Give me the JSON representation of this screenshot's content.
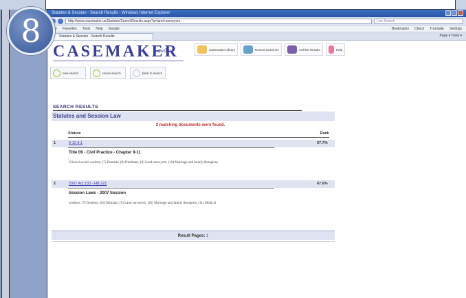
{
  "step_number": "8",
  "browser": {
    "title": "Statutes & Session - Search Results - Windows Internet Explorer",
    "url": "http://www.casemaker.us/Statutes/SearchResults.aspx?q=land+surveyors",
    "search_placeholder": "Live Search",
    "menu": [
      "File",
      "Favorites",
      "Tools",
      "Help",
      "Google",
      "Bookmarks",
      "Check",
      "Translate",
      "Settings"
    ],
    "tab_label": "Statutes & Session - Search Results",
    "tab_tools": "Page ▾  Tools ▾"
  },
  "header": {
    "brand": "CASEMAKER",
    "brand_sub": "Lawdex",
    "nav": [
      {
        "label": "Casemaker Library"
      },
      {
        "label": "Recent Searches"
      },
      {
        "label": "Archive Results"
      },
      {
        "label": "Help"
      }
    ],
    "subnav": [
      {
        "label": "new search"
      },
      {
        "label": "revise search"
      },
      {
        "label": "back to search"
      }
    ]
  },
  "results": {
    "heading": "SEARCH RESULTS",
    "section_title": "Statutes and Session Law",
    "message": "2 matching documents were found.",
    "col_statute": "Statute",
    "col_rank": "Rank",
    "items": [
      {
        "num": "1",
        "link": "9-11-9.1",
        "rank": "67.7%",
        "title": "Title 09 - Civil Practice - Chapter 9-11",
        "snippet": "Clinical social workers;  (7) Dentists;  (8) Dietitians;  (9) Land surveyors;  (10) Marriage and family therapists;"
      },
      {
        "num": "2",
        "link": "2007 Act 133 - HB 221",
        "rank": "67.6%",
        "title": "Session Laws - 2007 Session",
        "snippet": "workers;  (7) Dentists;  (8) Dietitians;  (9) Land surveyors;  (10) Marriage and family therapists;  (11) Medical"
      }
    ],
    "pages_label": "Result Pages:",
    "pages_value": "1"
  }
}
